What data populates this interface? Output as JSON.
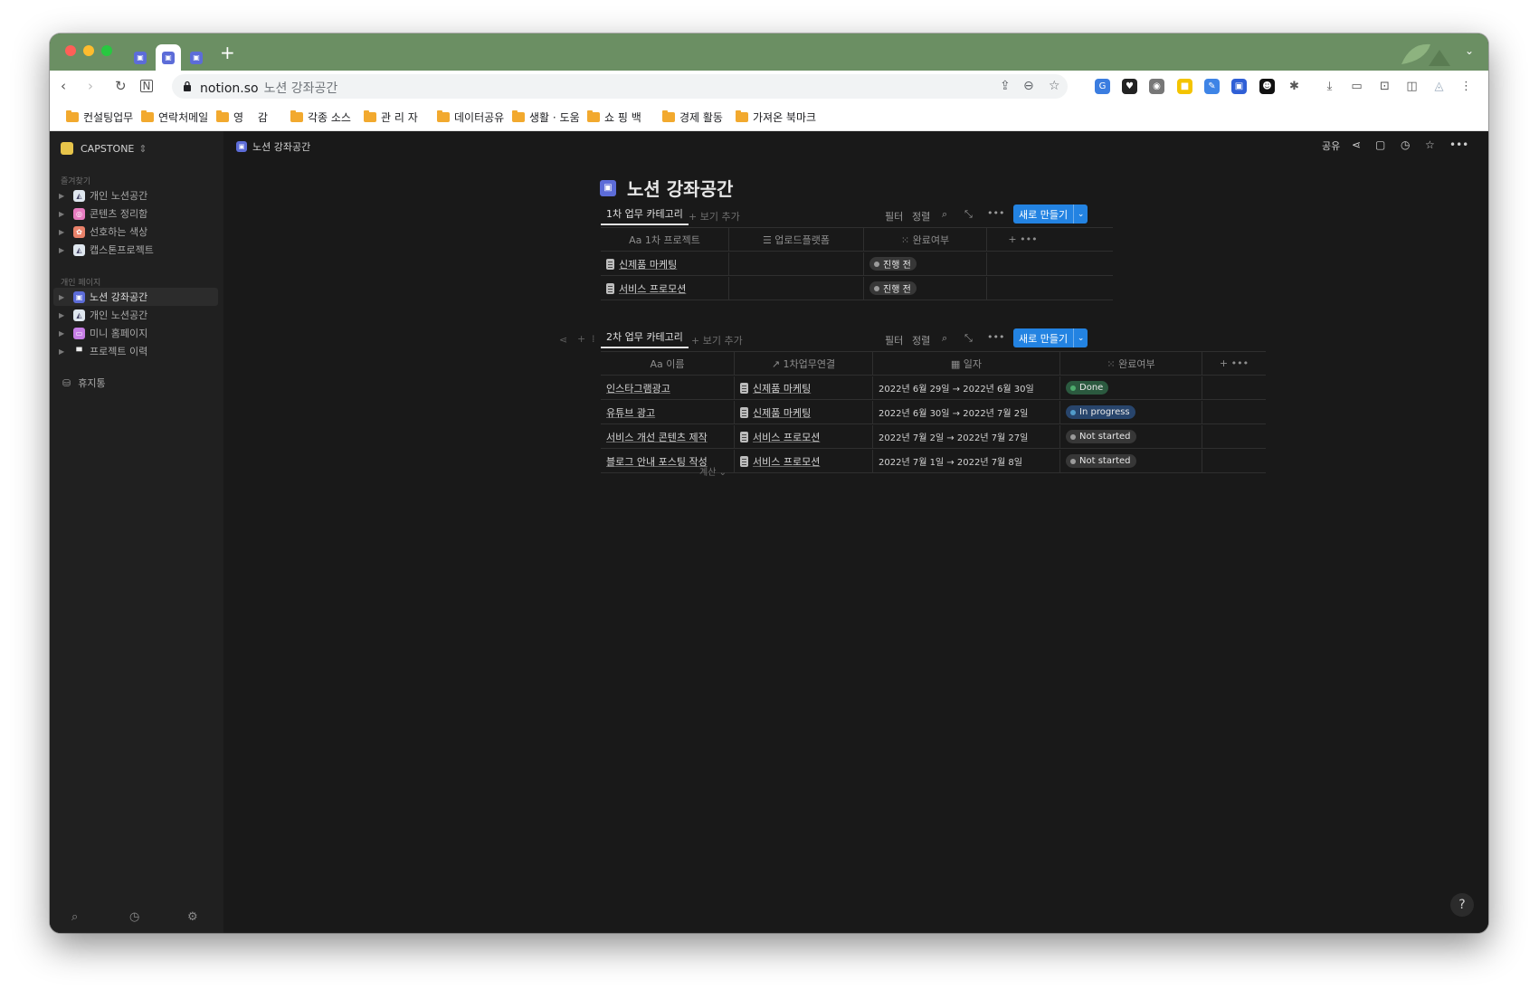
{
  "browser": {
    "tabs": [
      {
        "icon": "notion-page-icon"
      },
      {
        "icon": "notion-page-icon"
      },
      {
        "icon": "notion-page-icon"
      }
    ],
    "url_host": "notion.so",
    "url_path": "노션  강좌공간",
    "bookmarks": [
      "컨설팅업무",
      "연락처메일",
      "영 감",
      "각종 소스",
      "관 리 자",
      "데이터공유",
      "생활 · 도움",
      "쇼 핑 백",
      "경제 활동",
      "가져온 북마크"
    ]
  },
  "sidebar": {
    "workspace": "CAPSTONE",
    "favorites_label": "즐겨찾기",
    "favorites": [
      {
        "label": "개인  노션공간",
        "color": "#dfe7ef"
      },
      {
        "label": "콘텐츠  정리함",
        "color": "#e77cc0"
      },
      {
        "label": "선호하는  색상",
        "color": "#e9826a"
      },
      {
        "label": "캡스톤프로젝트",
        "color": "#dfe7ef"
      }
    ],
    "private_label": "개인 페이지",
    "private": [
      {
        "label": "노션  강좌공간",
        "color": "#5c6cd8"
      },
      {
        "label": "개인  노션공간",
        "color": "#dfe7ef"
      },
      {
        "label": "미니  홈페이지",
        "color": "#c67ee6"
      },
      {
        "label": "프로젝트  이력",
        "color": "#eeeeee"
      }
    ],
    "trash": "휴지통"
  },
  "topbar": {
    "breadcrumb": "노션  강좌공간",
    "share": "공유"
  },
  "page": {
    "title": "노션  강좌공간",
    "db1": {
      "tab": "1차 업무 카테고리",
      "add_view": "+ 보기 추가",
      "filter": "필터",
      "sort": "정렬",
      "new_button": "새로 만들기",
      "columns": [
        "Aa  1차 프로젝트",
        "☰  업로드플랫폼",
        "⁙  완료여부"
      ],
      "rows": [
        {
          "name": "신제품 마케팅",
          "platform": "",
          "status": "진행 전"
        },
        {
          "name": "서비스 프로모션",
          "platform": "",
          "status": "진행 전"
        }
      ]
    },
    "db2": {
      "tab": "2차 업무 카테고리",
      "add_view": "+ 보기 추가",
      "filter": "필터",
      "sort": "정렬",
      "new_button": "새로 만들기",
      "columns": [
        "Aa  이름",
        "↗  1차업무연결",
        "▦  일자",
        "⁙  완료여부"
      ],
      "rows": [
        {
          "name": "인스타그램광고",
          "link": "신제품 마케팅",
          "date": "2022년 6월 29일 → 2022년 6월 30일",
          "status": "Done"
        },
        {
          "name": "유튜브 광고",
          "link": "신제품 마케팅",
          "date": "2022년 6월 30일 → 2022년 7월 2일",
          "status": "In progress"
        },
        {
          "name": "서비스 개선 콘텐츠 제작",
          "link": "서비스 프로모션",
          "date": "2022년 7월 2일 → 2022년 7월 27일",
          "status": "Not started"
        },
        {
          "name": "블로그 안내 포스팅 작성",
          "link": "서비스 프로모션",
          "date": "2022년 7월 1일 → 2022년 7월 8일",
          "status": "Not started"
        }
      ],
      "calc": "계산 ⌄"
    },
    "status_colors": {
      "Done": {
        "bg": "#2b593f",
        "dot": "#4dab6d"
      },
      "In progress": {
        "bg": "#28456c",
        "dot": "#529cca"
      },
      "Not started": {
        "bg": "#373737",
        "dot": "#9b9b9b"
      },
      "진행 전": {
        "bg": "#373737",
        "dot": "#9b9b9b"
      }
    },
    "help": "?"
  }
}
